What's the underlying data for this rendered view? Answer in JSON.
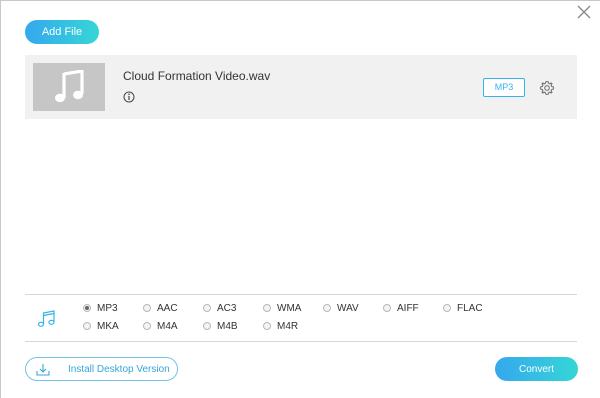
{
  "toolbar": {
    "add_file_label": "Add File"
  },
  "file": {
    "name": "Cloud Formation Video.wav",
    "output_format": "MP3"
  },
  "formats": {
    "selected": "MP3",
    "options": [
      "MP3",
      "AAC",
      "AC3",
      "WMA",
      "WAV",
      "AIFF",
      "FLAC",
      "MKA",
      "M4A",
      "M4B",
      "M4R"
    ]
  },
  "footer": {
    "install_label": "Install Desktop Version",
    "convert_label": "Convert"
  },
  "colors": {
    "accent_start": "#35a8ee",
    "accent_end": "#35d6d6",
    "row_background": "#f1f1f1",
    "thumbnail": "#c6c6c6"
  },
  "icons": [
    "close-icon",
    "music-note-icon",
    "info-icon",
    "gear-icon",
    "download-icon"
  ]
}
